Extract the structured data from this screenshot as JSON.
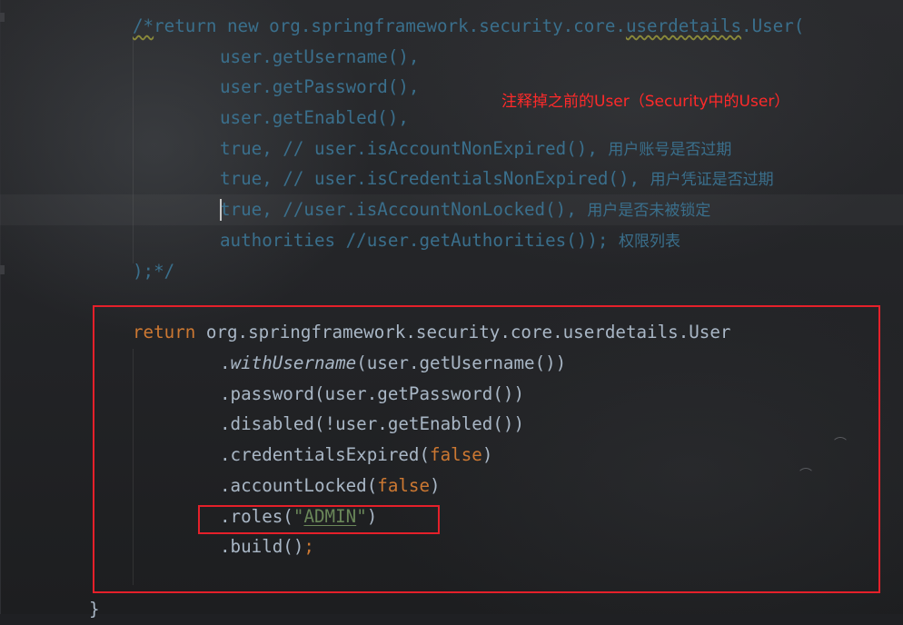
{
  "annotation": "注释掉之前的User（Security中的User）",
  "commented_code": {
    "line1_open": "/*",
    "line1_rest": "return new org.springframework.security.core.",
    "line1_squiggle": "userdetails",
    "line1_end": ".User(",
    "line2": "user.getUsername(),",
    "line3": "user.getPassword(),",
    "line4": "user.getEnabled(),",
    "line5_code": "true, // user.isAccountNonExpired(), ",
    "line5_cjk": "用户账号是否过期",
    "line6_code": "true, // user.isCredentialsNonExpired(), ",
    "line6_cjk": "用户凭证是否过期",
    "line7_code": "true, //user.isAccountNonLocked(), ",
    "line7_cjk": "用户是否未被锁定",
    "line8_code": "authorities //user.getAuthorities()); ",
    "line8_cjk": "权限列表",
    "line9": ");*/"
  },
  "active_code": {
    "return_kw": "return",
    "return_rest": " org.springframework.security.core.userdetails.User",
    "with_dot": ".",
    "with_method": "withUsername",
    "with_args": "(user.getUsername())",
    "password": ".password(user.getPassword())",
    "disabled": ".disabled(!user.getEnabled())",
    "cred_open": ".credentialsExpired(",
    "cred_false": "false",
    "cred_close": ")",
    "locked_open": ".accountLocked(",
    "locked_false": "false",
    "locked_close": ")",
    "roles_open": ".roles(",
    "roles_quote_l": "\"",
    "roles_value": "ADMIN",
    "roles_quote_r": "\"",
    "roles_close": ")",
    "build": ".build()",
    "build_semi": ";"
  },
  "closing_brace": "}",
  "colors": {
    "comment": "#3a6f8c",
    "keyword": "#cc7832",
    "string": "#6a8759",
    "plain": "#a9b7c6",
    "annotation": "#ff2a2a",
    "highlight_box": "#e5202a"
  }
}
